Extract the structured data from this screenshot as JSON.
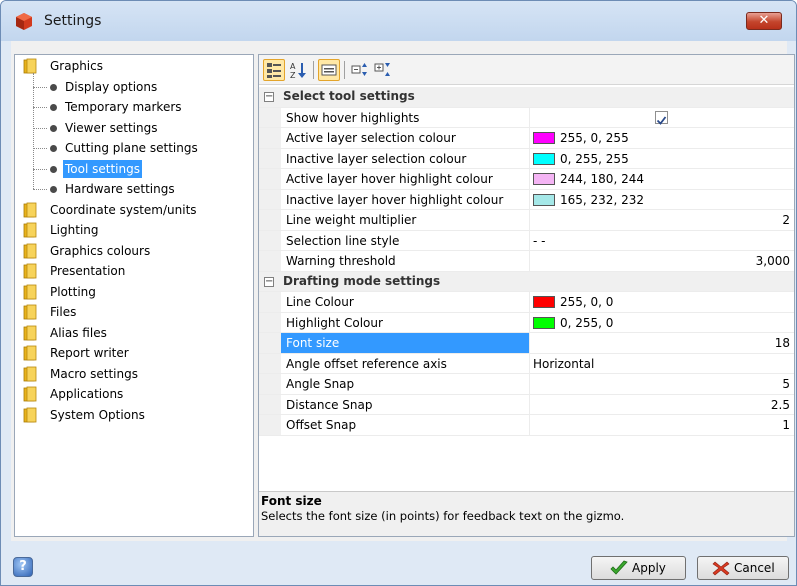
{
  "window": {
    "title": "Settings",
    "close_glyph": "✕"
  },
  "tree": {
    "items": [
      {
        "label": "Graphics",
        "type": "folder",
        "selected": false
      },
      {
        "label": "Display options",
        "type": "leaf",
        "selected": false
      },
      {
        "label": "Temporary markers",
        "type": "leaf",
        "selected": false
      },
      {
        "label": "Viewer settings",
        "type": "leaf",
        "selected": false
      },
      {
        "label": "Cutting plane settings",
        "type": "leaf",
        "selected": false
      },
      {
        "label": "Tool settings",
        "type": "leaf",
        "selected": true
      },
      {
        "label": "Hardware settings",
        "type": "leaf",
        "selected": false
      },
      {
        "label": "Coordinate system/units",
        "type": "folder",
        "selected": false
      },
      {
        "label": "Lighting",
        "type": "folder",
        "selected": false
      },
      {
        "label": "Graphics colours",
        "type": "folder",
        "selected": false
      },
      {
        "label": "Presentation",
        "type": "folder",
        "selected": false
      },
      {
        "label": "Plotting",
        "type": "folder",
        "selected": false
      },
      {
        "label": "Files",
        "type": "folder",
        "selected": false
      },
      {
        "label": "Alias files",
        "type": "folder",
        "selected": false
      },
      {
        "label": "Report writer",
        "type": "folder",
        "selected": false
      },
      {
        "label": "Macro settings",
        "type": "folder",
        "selected": false
      },
      {
        "label": "Applications",
        "type": "folder",
        "selected": false
      },
      {
        "label": "System Options",
        "type": "folder",
        "selected": false
      }
    ]
  },
  "toolbar": {
    "buttons": [
      {
        "icon": "categorized-icon",
        "active": true
      },
      {
        "icon": "sort-alpha-icon",
        "active": false
      },
      {
        "icon": "property-pages-icon",
        "active": true
      },
      {
        "icon": "expand-all-icon",
        "active": false
      },
      {
        "icon": "collapse-all-icon",
        "active": false
      }
    ]
  },
  "grid": {
    "categories": [
      {
        "label": "Select tool settings",
        "expander": "−",
        "rows": [
          {
            "name": "Show hover highlights",
            "kind": "checkbox",
            "checked": true
          },
          {
            "name": "Active layer selection colour",
            "kind": "color",
            "color": "#ff00ff",
            "value": "255, 0, 255"
          },
          {
            "name": "Inactive layer selection colour",
            "kind": "color",
            "color": "#00ffff",
            "value": "0, 255, 255"
          },
          {
            "name": "Active layer hover highlight colour",
            "kind": "color",
            "color": "#f4b4f4",
            "value": "244, 180, 244"
          },
          {
            "name": "Inactive layer hover highlight colour",
            "kind": "color",
            "color": "#a5e8e8",
            "value": "165, 232, 232"
          },
          {
            "name": "Line weight multiplier",
            "kind": "number",
            "value": "2"
          },
          {
            "name": "Selection line style",
            "kind": "text",
            "value": "- -"
          },
          {
            "name": "Warning threshold",
            "kind": "number",
            "value": "3,000"
          }
        ]
      },
      {
        "label": "Drafting mode settings",
        "expander": "−",
        "rows": [
          {
            "name": "Line Colour",
            "kind": "color",
            "color": "#ff0000",
            "value": "255, 0, 0"
          },
          {
            "name": "Highlight Colour",
            "kind": "color",
            "color": "#00ff00",
            "value": "0, 255, 0"
          },
          {
            "name": "Font size",
            "kind": "number",
            "value": "18",
            "selected": true
          },
          {
            "name": "Angle offset reference axis",
            "kind": "text",
            "value": "Horizontal"
          },
          {
            "name": "Angle Snap",
            "kind": "number",
            "value": "5"
          },
          {
            "name": "Distance Snap",
            "kind": "number",
            "value": "2.5"
          },
          {
            "name": "Offset Snap",
            "kind": "number",
            "value": "1"
          }
        ]
      }
    ]
  },
  "description": {
    "title": "Font size",
    "text": "Selects the font size (in points) for feedback text on the gizmo."
  },
  "buttons": {
    "help_glyph": "?",
    "apply_label": "Apply",
    "cancel_label": "Cancel"
  },
  "colors": {
    "selection": "#3399ff",
    "window_frame": "#dfe9f5"
  }
}
